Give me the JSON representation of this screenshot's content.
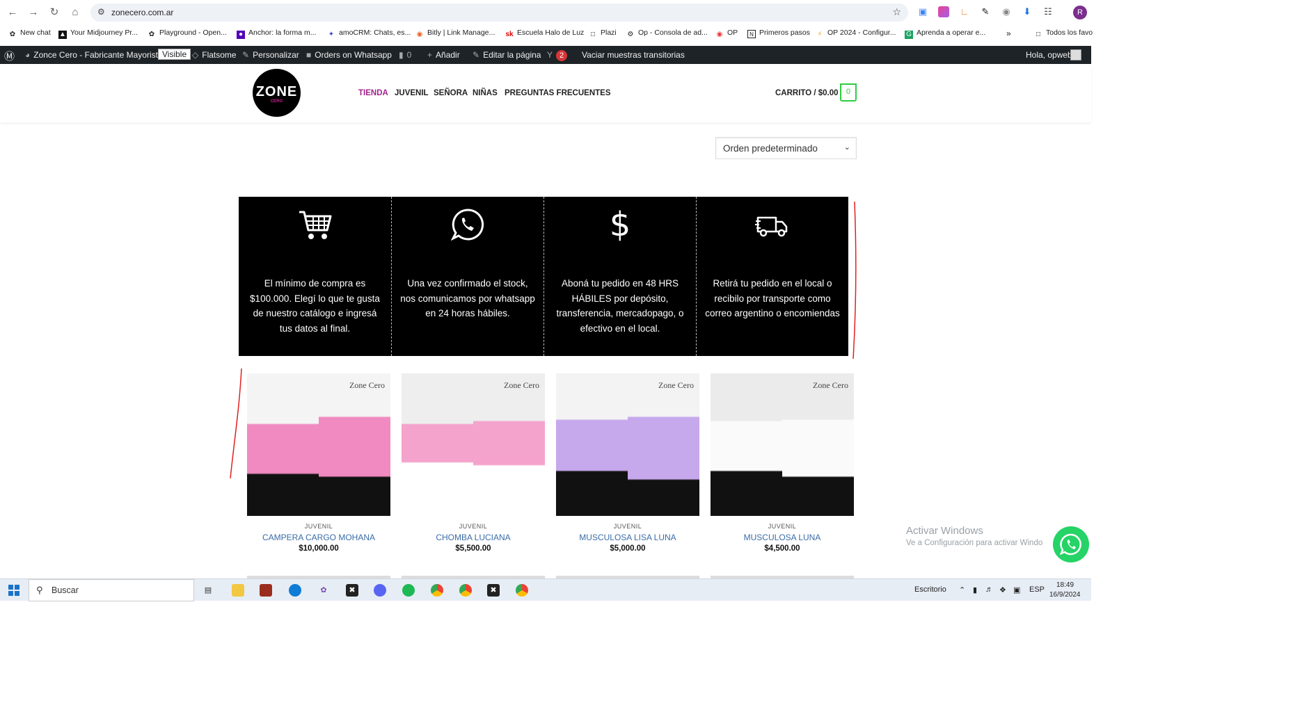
{
  "browser": {
    "url": "zonecero.com.ar",
    "bookmarks": [
      "New chat",
      "Your Midjourney Pr...",
      "Playground - Open...",
      "Anchor: la forma m...",
      "amoCRM: Chats, es...",
      "Bitly | Link Manage...",
      "Escuela Halo de Luz",
      "Plazi",
      "Op - Consola de ad...",
      "OP",
      "Primeros pasos",
      "OP 2024 - Configur...",
      "Aprenda a operar e...",
      "Todos los favo"
    ],
    "profile_initial": "R"
  },
  "wpbar": {
    "site_name": "Zonce Cero - Fabricante Mayorista",
    "visible_badge": "Visible",
    "flatsome": "Flatsome",
    "personalizar": "Personalizar",
    "orders": "Orders on Whatsapp",
    "comments": "0",
    "add": "Añadir",
    "edit": "Editar la página",
    "yoast_count": "2",
    "purge": "Vaciar muestras transitorias",
    "greeting": "Hola, opweb"
  },
  "header": {
    "logo_main": "ZONE",
    "logo_sub": "CERO",
    "menu": [
      "TIENDA",
      "JUVENIL",
      "SEÑORA",
      "NIÑAS",
      "PREGUNTAS FRECUENTES"
    ],
    "cart_label": "CARRITO / $0.00",
    "cart_count": "0",
    "active_color": "#a3228c",
    "cart_color": "#2ecc40"
  },
  "sort": {
    "selected": "Orden predeterminado"
  },
  "info_boxes": [
    {
      "icon": "cart-icon",
      "text": "El mínimo de compra es $100.000. Elegí lo que te gusta de nuestro catálogo e ingresá tus datos al final."
    },
    {
      "icon": "whatsapp-icon",
      "text": "Una vez confirmado el stock, nos comunicamos por whatsapp en 24 horas hábiles."
    },
    {
      "icon": "dollar-icon",
      "text": "Aboná tu pedido en 48 HRS HÁBILES por depósito, transferencia, mercadopago, o efectivo en el local."
    },
    {
      "icon": "truck-icon",
      "text": "Retirá tu pedido en el local o recibilo por transporte como correo argentino o encomiendas"
    }
  ],
  "products": [
    {
      "category": "JUVENIL",
      "title": "CAMPERA CARGO MOHANA",
      "price": "$10,000.00",
      "brand": "Zone Cero",
      "color": "#f08ac0"
    },
    {
      "category": "JUVENIL",
      "title": "CHOMBA LUCIANA",
      "price": "$5,500.00",
      "brand": "Zone Cero",
      "color": "#f4a3cc"
    },
    {
      "category": "JUVENIL",
      "title": "MUSCULOSA LISA LUNA",
      "price": "$5,000.00",
      "brand": "Zone Cero",
      "color": "#c6a8ec"
    },
    {
      "category": "JUVENIL",
      "title": "MUSCULOSA LUNA",
      "price": "$4,500.00",
      "brand": "Zone Cero",
      "color": "#f2f2f2"
    }
  ],
  "windows": {
    "activate_title": "Activar Windows",
    "activate_sub": "Ve a Configuración para activar Windo",
    "search": "Buscar",
    "desktop": "Escritorio",
    "lang": "ESP",
    "time": "18:49",
    "date": "16/9/2024"
  }
}
